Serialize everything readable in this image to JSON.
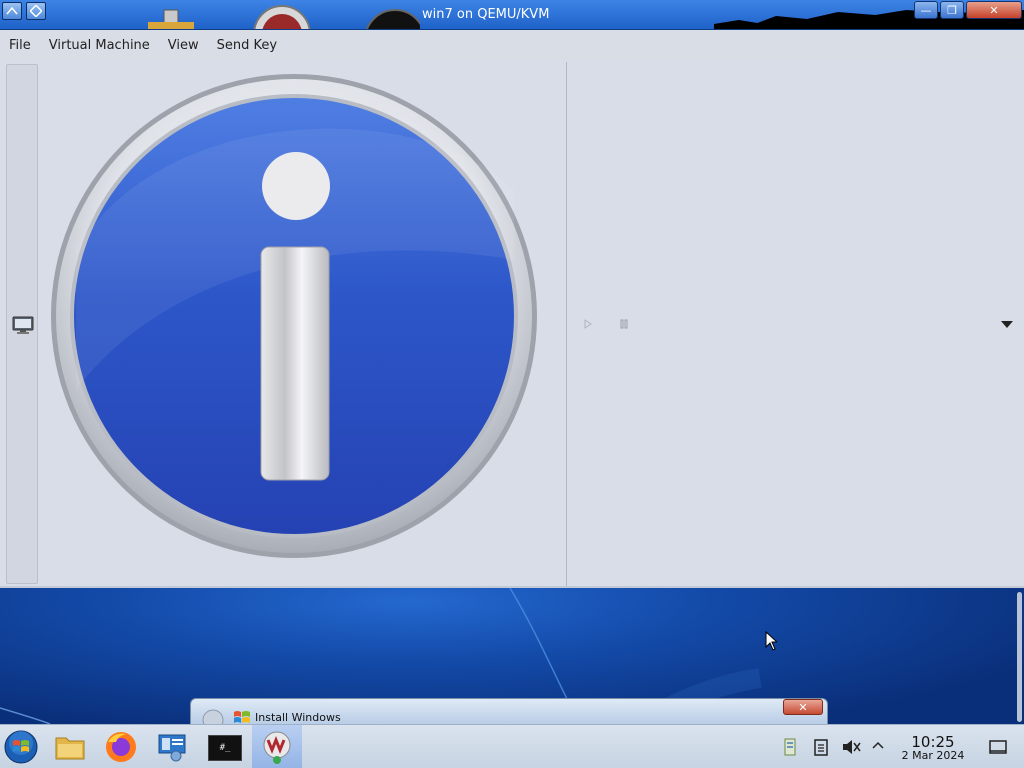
{
  "window": {
    "title": "win7 on QEMU/KVM",
    "minimize_glyph": "—",
    "maximize_glyph": "❐",
    "close_glyph": "✕"
  },
  "menubar": {
    "items": [
      "File",
      "Virtual Machine",
      "View",
      "Send Key"
    ]
  },
  "viewer": {
    "monitor_icon": "monitor-icon",
    "info_icon": "info-icon",
    "play_icon": "play-icon",
    "pause_icon": "pause-icon",
    "dropdown_icon": "dropdown-icon"
  },
  "dialog": {
    "title": "Install Windows",
    "close_glyph": "✕"
  },
  "taskbar": {
    "time": "10:25",
    "date": "2 Mar 2024",
    "apps": [
      "start-orb-icon",
      "folder-icon",
      "firefox-icon",
      "network-icon",
      "terminal-icon",
      "virt-manager-icon"
    ],
    "terminal_label": "#_"
  },
  "colors": {
    "titlebar": "#2a6fd6",
    "app_background": "#d8dde8",
    "desktop": "#134aa8",
    "info_blue": "#2a4fc0"
  }
}
